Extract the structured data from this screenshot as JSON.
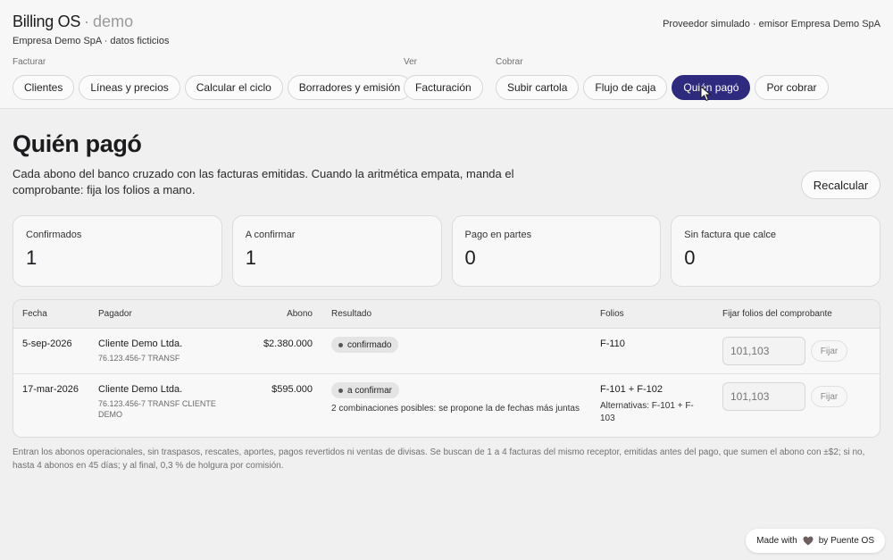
{
  "header": {
    "title": "Billing OS",
    "separator": "·",
    "mode": "demo",
    "subtitle": "Empresa Demo SpA · datos ficticios",
    "provider": "Proveedor simulado · emisor Empresa Demo SpA"
  },
  "nav": {
    "groups": [
      {
        "label": "Facturar",
        "items": [
          "Clientes",
          "Líneas y precios",
          "Calcular el ciclo",
          "Borradores y emisión"
        ]
      },
      {
        "label": "Ver",
        "items": [
          "Facturación"
        ]
      },
      {
        "label": "Cobrar",
        "items": [
          "Subir cartola",
          "Flujo de caja",
          "Quién pagó",
          "Por cobrar"
        ]
      }
    ],
    "active": "Quién pagó",
    "accent": "#2e2a7d"
  },
  "page": {
    "title": "Quién pagó",
    "description": "Cada abono del banco cruzado con las facturas emitidas. Cuando la aritmética empata, manda el comprobante: fija los folios a mano.",
    "recalc_label": "Recalcular"
  },
  "stats": [
    {
      "label": "Confirmados",
      "value": "1"
    },
    {
      "label": "A confirmar",
      "value": "1"
    },
    {
      "label": "Pago en partes",
      "value": "0"
    },
    {
      "label": "Sin factura que calce",
      "value": "0"
    }
  ],
  "table": {
    "headers": [
      "Fecha",
      "Pagador",
      "Abono",
      "Resultado",
      "Folios",
      "Fijar folios del comprobante"
    ],
    "rows": [
      {
        "date": "5-sep-2026",
        "payer": "Cliente Demo Ltda.",
        "payer_sub": "76.123.456-7 TRANSF",
        "amount": "$2.380.000",
        "status": "confirmado",
        "note": "",
        "folios": "F-110",
        "folios_alt": "",
        "input_placeholder": "101,103",
        "fix_label": "Fijar"
      },
      {
        "date": "17-mar-2026",
        "payer": "Cliente Demo Ltda.",
        "payer_sub": "76.123.456-7 TRANSF CLIENTE DEMO",
        "amount": "$595.000",
        "status": "a confirmar",
        "note": "2 combinaciones posibles: se propone la de fechas más juntas",
        "folios": "F-101 + F-102",
        "folios_alt": "Alternativas: F-101 + F-103",
        "input_placeholder": "101,103",
        "fix_label": "Fijar"
      }
    ]
  },
  "footnote": "Entran los abonos operacionales, sin traspasos, rescates, aportes, pagos revertidos ni ventas de divisas. Se buscan de 1 a 4 facturas del mismo receptor, emitidas antes del pago, que sumen el abono con ±$2; si no, hasta 4 abonos en 45 días; y al final, 0,3 % de holgura por comisión.",
  "badge": {
    "made_with": "Made with",
    "by": "by Puente OS",
    "icon": "heart-icon"
  }
}
